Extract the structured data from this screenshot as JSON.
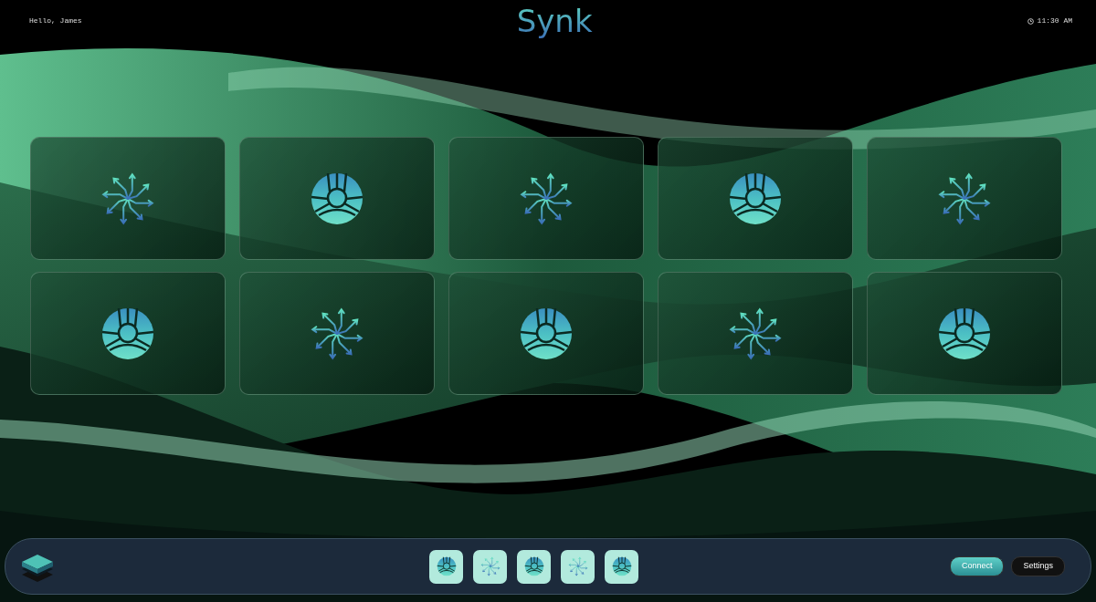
{
  "header": {
    "greeting": "Hello, James",
    "title": "Synk",
    "time": "11:30 AM"
  },
  "tiles": [
    {
      "kind": "burst"
    },
    {
      "kind": "orb"
    },
    {
      "kind": "burst"
    },
    {
      "kind": "orb"
    },
    {
      "kind": "burst"
    },
    {
      "kind": "orb"
    },
    {
      "kind": "burst"
    },
    {
      "kind": "orb"
    },
    {
      "kind": "burst"
    },
    {
      "kind": "orb"
    }
  ],
  "dock": {
    "apps": [
      {
        "kind": "orb"
      },
      {
        "kind": "burst"
      },
      {
        "kind": "orb"
      },
      {
        "kind": "burst"
      },
      {
        "kind": "orb"
      }
    ],
    "buttons": [
      {
        "label": "Connect",
        "kind": "primary"
      },
      {
        "label": "Settings",
        "kind": "dark"
      }
    ]
  }
}
